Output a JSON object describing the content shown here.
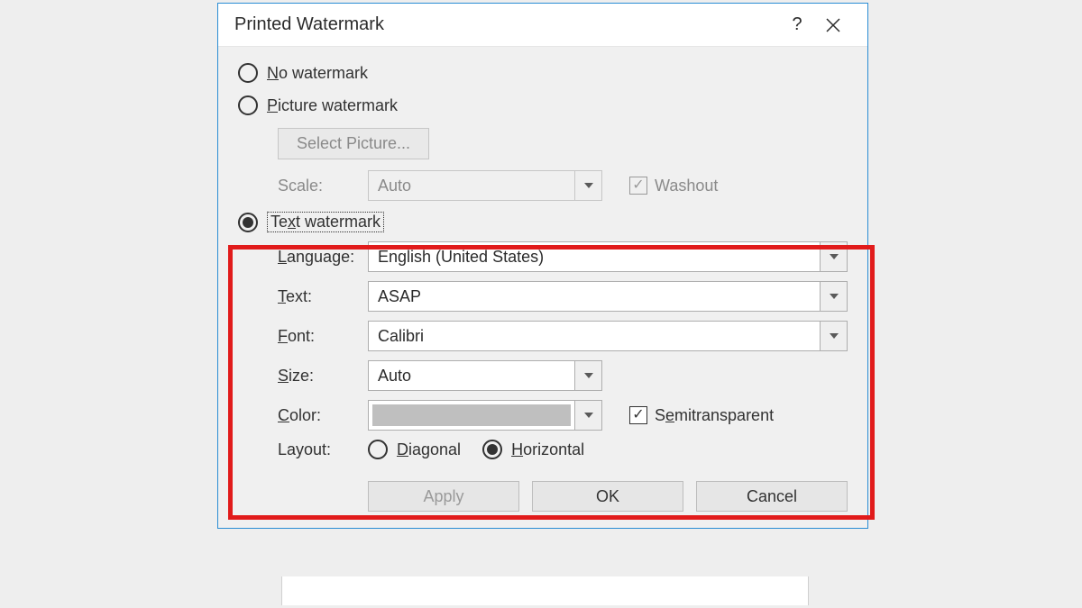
{
  "dialog": {
    "title": "Printed Watermark",
    "help_symbol": "?",
    "radios": {
      "no_watermark": {
        "prefix": "N",
        "rest": "o watermark"
      },
      "picture_watermark": {
        "prefix": "P",
        "rest": "icture watermark"
      },
      "text_watermark": {
        "prefix": "Te",
        "under": "x",
        "rest": "t watermark"
      }
    },
    "picture": {
      "select_button": "Select Picture...",
      "scale_label": "Scale:",
      "scale_value": "Auto",
      "washout_label": "Washout"
    },
    "text": {
      "language_label_u": "L",
      "language_label_r": "anguage:",
      "language_value": "English (United States)",
      "text_label_u": "T",
      "text_label_r": "ext:",
      "text_value": "ASAP",
      "font_label_u": "F",
      "font_label_r": "ont:",
      "font_value": "Calibri",
      "size_label_u": "S",
      "size_label_r": "ize:",
      "size_value": "Auto",
      "color_label_u": "C",
      "color_label_r": "olor:",
      "semitransparent_pre": "S",
      "semitransparent_u": "e",
      "semitransparent_r": "mitransparent",
      "layout_label": "Layout:",
      "diagonal_u": "D",
      "diagonal_r": "iagonal",
      "horizontal_u": "H",
      "horizontal_r": "orizontal"
    },
    "buttons": {
      "apply": "Apply",
      "ok": "OK",
      "cancel": "Cancel"
    }
  }
}
